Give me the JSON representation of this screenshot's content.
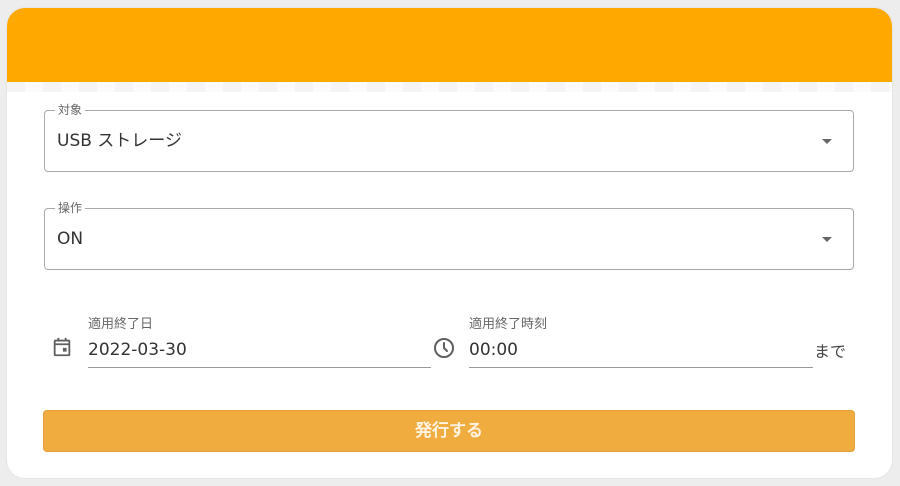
{
  "theme": {
    "header_color": "#ffa800",
    "button_color": "#f0ac3f"
  },
  "form": {
    "target": {
      "label": "対象",
      "value": "USB ストレージ"
    },
    "operation": {
      "label": "操作",
      "value": "ON"
    },
    "end_date": {
      "label": "適用終了日",
      "value": "2022-03-30",
      "icon": "calendar-icon"
    },
    "end_time": {
      "label": "適用終了時刻",
      "value": "00:00",
      "icon": "clock-icon"
    },
    "until_text": "まで",
    "submit_label": "発行する"
  }
}
